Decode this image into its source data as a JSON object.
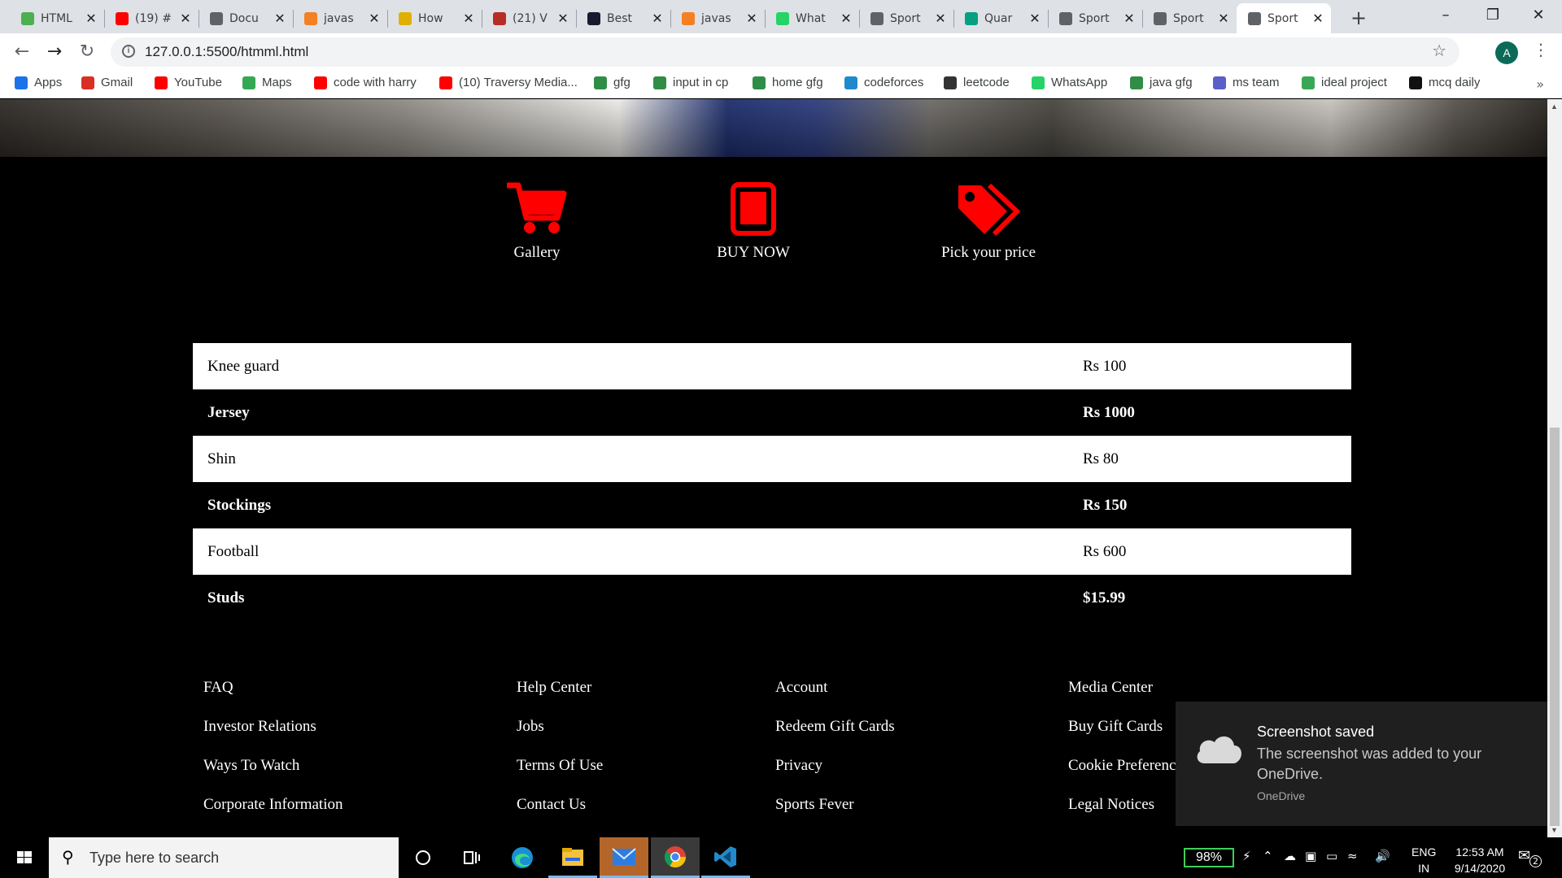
{
  "browser": {
    "tabs": [
      {
        "title": "HTML",
        "icon": "w3schools-icon",
        "color": "#4caf50"
      },
      {
        "title": "(19) #",
        "icon": "youtube-icon",
        "color": "#ff0000"
      },
      {
        "title": "Docu",
        "icon": "globe-icon",
        "color": "#5f6368"
      },
      {
        "title": "javas",
        "icon": "stackoverflow-icon",
        "color": "#f48024"
      },
      {
        "title": "How",
        "icon": "codegrepper-icon",
        "color": "#e0b000"
      },
      {
        "title": "(21) V",
        "icon": "quora-icon",
        "color": "#b92b27"
      },
      {
        "title": "Best",
        "icon": "angular-icon",
        "color": "#1a1a2e"
      },
      {
        "title": "javas",
        "icon": "stackoverflow-icon",
        "color": "#f48024"
      },
      {
        "title": "What",
        "icon": "whatsapp-icon",
        "color": "#25d366"
      },
      {
        "title": "Sport",
        "icon": "globe-icon",
        "color": "#5f6368"
      },
      {
        "title": "Quar",
        "icon": "pexels-icon",
        "color": "#05a081"
      },
      {
        "title": "Sport",
        "icon": "globe-icon",
        "color": "#5f6368"
      },
      {
        "title": "Sport",
        "icon": "globe-icon",
        "color": "#5f6368"
      },
      {
        "title": "Sport",
        "icon": "globe-icon",
        "color": "#5f6368"
      }
    ],
    "active_tab_index": 13,
    "url": "127.0.0.1:5500/htmml.html",
    "profile_initial": "A",
    "bookmarks": [
      {
        "label": "Apps",
        "icon": "apps-grid-icon",
        "color": "#1a73e8"
      },
      {
        "label": "Gmail",
        "icon": "gmail-icon",
        "color": "#d93025"
      },
      {
        "label": "YouTube",
        "icon": "youtube-icon",
        "color": "#ff0000"
      },
      {
        "label": "Maps",
        "icon": "maps-pin-icon",
        "color": "#34a853"
      },
      {
        "label": "code with harry",
        "icon": "youtube-icon",
        "color": "#ff0000"
      },
      {
        "label": "(10) Traversy Media...",
        "icon": "youtube-icon",
        "color": "#ff0000"
      },
      {
        "label": "gfg",
        "icon": "geeksforgeeks-icon",
        "color": "#2f8d46"
      },
      {
        "label": "input in cp",
        "icon": "geeksforgeeks-icon",
        "color": "#2f8d46"
      },
      {
        "label": "home gfg",
        "icon": "geeksforgeeks-icon",
        "color": "#2f8d46"
      },
      {
        "label": "codeforces",
        "icon": "codeforces-icon",
        "color": "#1f8acb"
      },
      {
        "label": "leetcode",
        "icon": "leetcode-icon",
        "color": "#333333"
      },
      {
        "label": "WhatsApp",
        "icon": "whatsapp-icon",
        "color": "#25d366"
      },
      {
        "label": "java gfg",
        "icon": "geeksforgeeks-icon",
        "color": "#2f8d46"
      },
      {
        "label": "ms team",
        "icon": "teams-icon",
        "color": "#5b5fc7"
      },
      {
        "label": "ideal project",
        "icon": "ideal-project-icon",
        "color": "#3aa757"
      },
      {
        "label": "mcq daily",
        "icon": "sanfoundry-icon",
        "color": "#111111"
      }
    ]
  },
  "page": {
    "features": [
      {
        "label": "Gallery",
        "icon": "shopping-cart-icon"
      },
      {
        "label": "BUY NOW",
        "icon": "tablet-icon"
      },
      {
        "label": "Pick your price",
        "icon": "price-tags-icon"
      }
    ],
    "accent_color": "#ff0000",
    "price_rows": [
      {
        "item": "Knee guard",
        "price": "Rs 100",
        "style": "light"
      },
      {
        "item": "Jersey",
        "price": "Rs 1000",
        "style": "dark"
      },
      {
        "item": "Shin",
        "price": "Rs 80",
        "style": "light"
      },
      {
        "item": "Stockings",
        "price": "Rs 150",
        "style": "dark"
      },
      {
        "item": "Football",
        "price": "Rs 600",
        "style": "light"
      },
      {
        "item": "Studs",
        "price": "$15.99",
        "style": "dark"
      }
    ],
    "footer_columns": [
      [
        "FAQ",
        "Investor Relations",
        "Ways To Watch",
        "Corporate Information"
      ],
      [
        "Help Center",
        "Jobs",
        "Terms Of Use",
        "Contact Us"
      ],
      [
        "Account",
        "Redeem Gift Cards",
        "Privacy",
        "Sports Fever"
      ],
      [
        "Media Center",
        "Buy Gift Cards",
        "Cookie Preferences",
        "Legal Notices"
      ]
    ]
  },
  "toast": {
    "title": "Screenshot saved",
    "body": "The screenshot was added to your OneDrive.",
    "app": "OneDrive",
    "icon": "onedrive-cloud-icon"
  },
  "taskbar": {
    "search_placeholder": "Type here to search",
    "apps": [
      "cortana-icon",
      "task-view-icon",
      "edge-icon",
      "file-explorer-icon",
      "mail-icon",
      "chrome-icon",
      "vscode-icon"
    ],
    "battery": "98%",
    "language": "ENG",
    "region": "IN",
    "time": "12:53 AM",
    "date": "9/14/2020",
    "notification_count": "2"
  }
}
